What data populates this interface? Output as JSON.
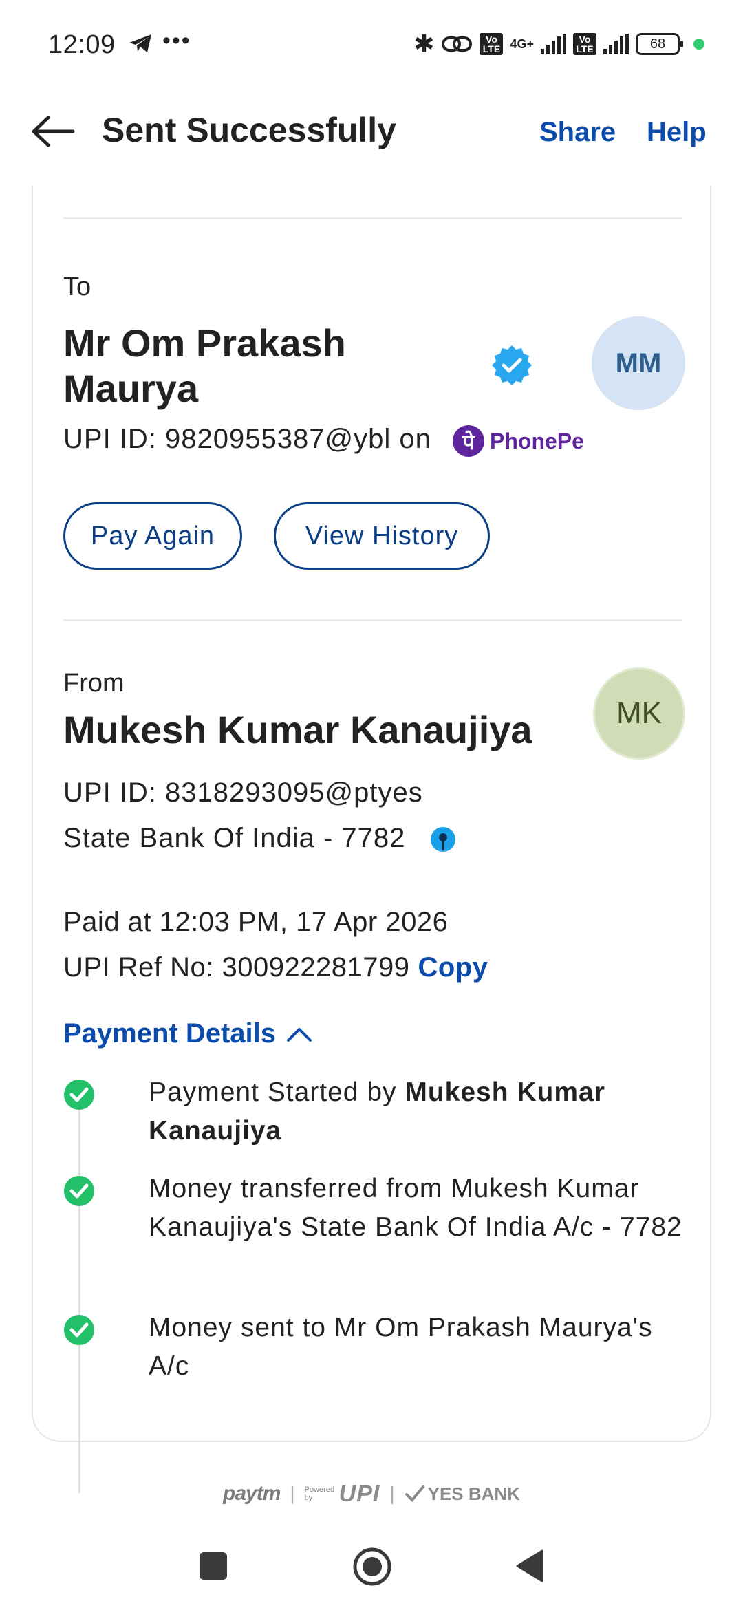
{
  "status_bar": {
    "time": "12:09",
    "dots": "•••",
    "bluetooth": "✱",
    "volte1": "Vo LTE",
    "network": "4G+",
    "volte2": "Vo LTE",
    "battery": "68"
  },
  "header": {
    "title": "Sent Successfully",
    "share": "Share",
    "help": "Help"
  },
  "payee": {
    "label": "To",
    "name": "Mr Om Prakash Maurya",
    "initials": "MM",
    "upi_id": "UPI ID: 9820955387@ybl on",
    "app": "PhonePe"
  },
  "actions": {
    "pay_again": "Pay Again",
    "view_history": "View History"
  },
  "payer": {
    "label": "From",
    "name": "Mukesh Kumar Kanaujiya",
    "initials": "MK",
    "upi_id": "UPI ID: 8318293095@ptyes",
    "bank": "State Bank Of India - 7782"
  },
  "transaction": {
    "paid_at": "Paid at 12:03 PM, 17 Apr 2026",
    "ref_no": "UPI Ref No: 300922281799",
    "copy": "Copy"
  },
  "payment_details": {
    "label": "Payment Details",
    "steps": [
      {
        "prefix": "Payment Started by ",
        "bold": "Mukesh Kumar Kanaujiya"
      },
      {
        "text": "Money transferred from Mukesh Kumar Kanaujiya's State Bank Of India A/c - 7782"
      },
      {
        "text": "Money sent to Mr Om Prakash Maurya's A/c"
      }
    ]
  },
  "footer": {
    "paytm": "paytm",
    "powered_by": "Powered by",
    "upi": "UPI",
    "yes_bank": "YES BANK"
  },
  "colors": {
    "accent": "#0a4bab",
    "button_border": "#0b3f86",
    "success": "#22c069",
    "verified": "#29a8f0",
    "phonepe": "#5f259f"
  }
}
